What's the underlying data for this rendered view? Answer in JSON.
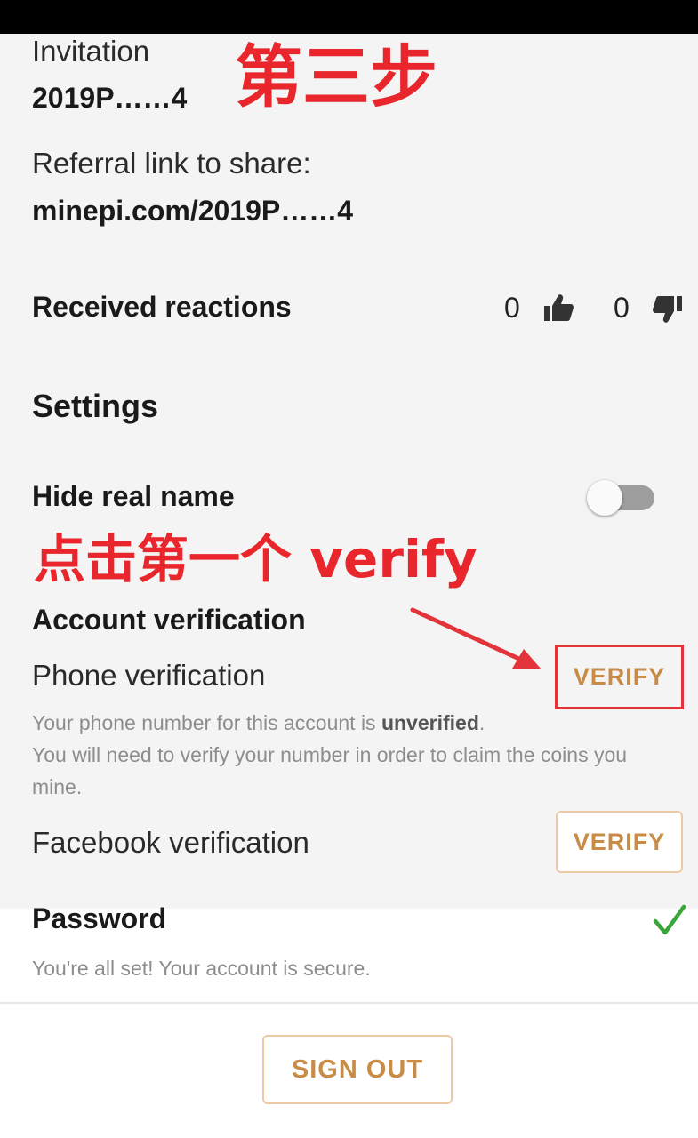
{
  "annotations": {
    "step": "第三步",
    "instruction": "点击第一个 verify"
  },
  "invitation": {
    "label": "Invitation",
    "code": "2019P……4",
    "referral_label": "Referral link to share:",
    "referral_link": "minepi.com/2019P……4"
  },
  "reactions": {
    "title": "Received reactions",
    "thumbs_up_count": "0",
    "thumbs_down_count": "0",
    "up_icon": "thumbs-up-icon",
    "down_icon": "thumbs-down-icon"
  },
  "settings": {
    "title": "Settings",
    "hide_real_name": {
      "label": "Hide real name",
      "enabled": false
    }
  },
  "account_verification": {
    "title": "Account verification",
    "phone": {
      "label": "Phone verification",
      "button": "VERIFY",
      "help_prefix": "Your phone number for this account is ",
      "help_status": "unverified",
      "help_suffix": ".",
      "help_line2": "You will need to verify your number in order to claim the coins you mine."
    },
    "facebook": {
      "label": "Facebook verification",
      "button": "VERIFY"
    }
  },
  "password": {
    "title": "Password",
    "status_text": "You're all set! Your account is secure.",
    "status_icon": "checkmark-icon",
    "status_color": "#3aa639"
  },
  "sign_out": {
    "label": "SIGN OUT"
  },
  "colors": {
    "annotation": "#e8262b",
    "button_text": "#c98c47",
    "button_border": "#ecc9a4"
  }
}
